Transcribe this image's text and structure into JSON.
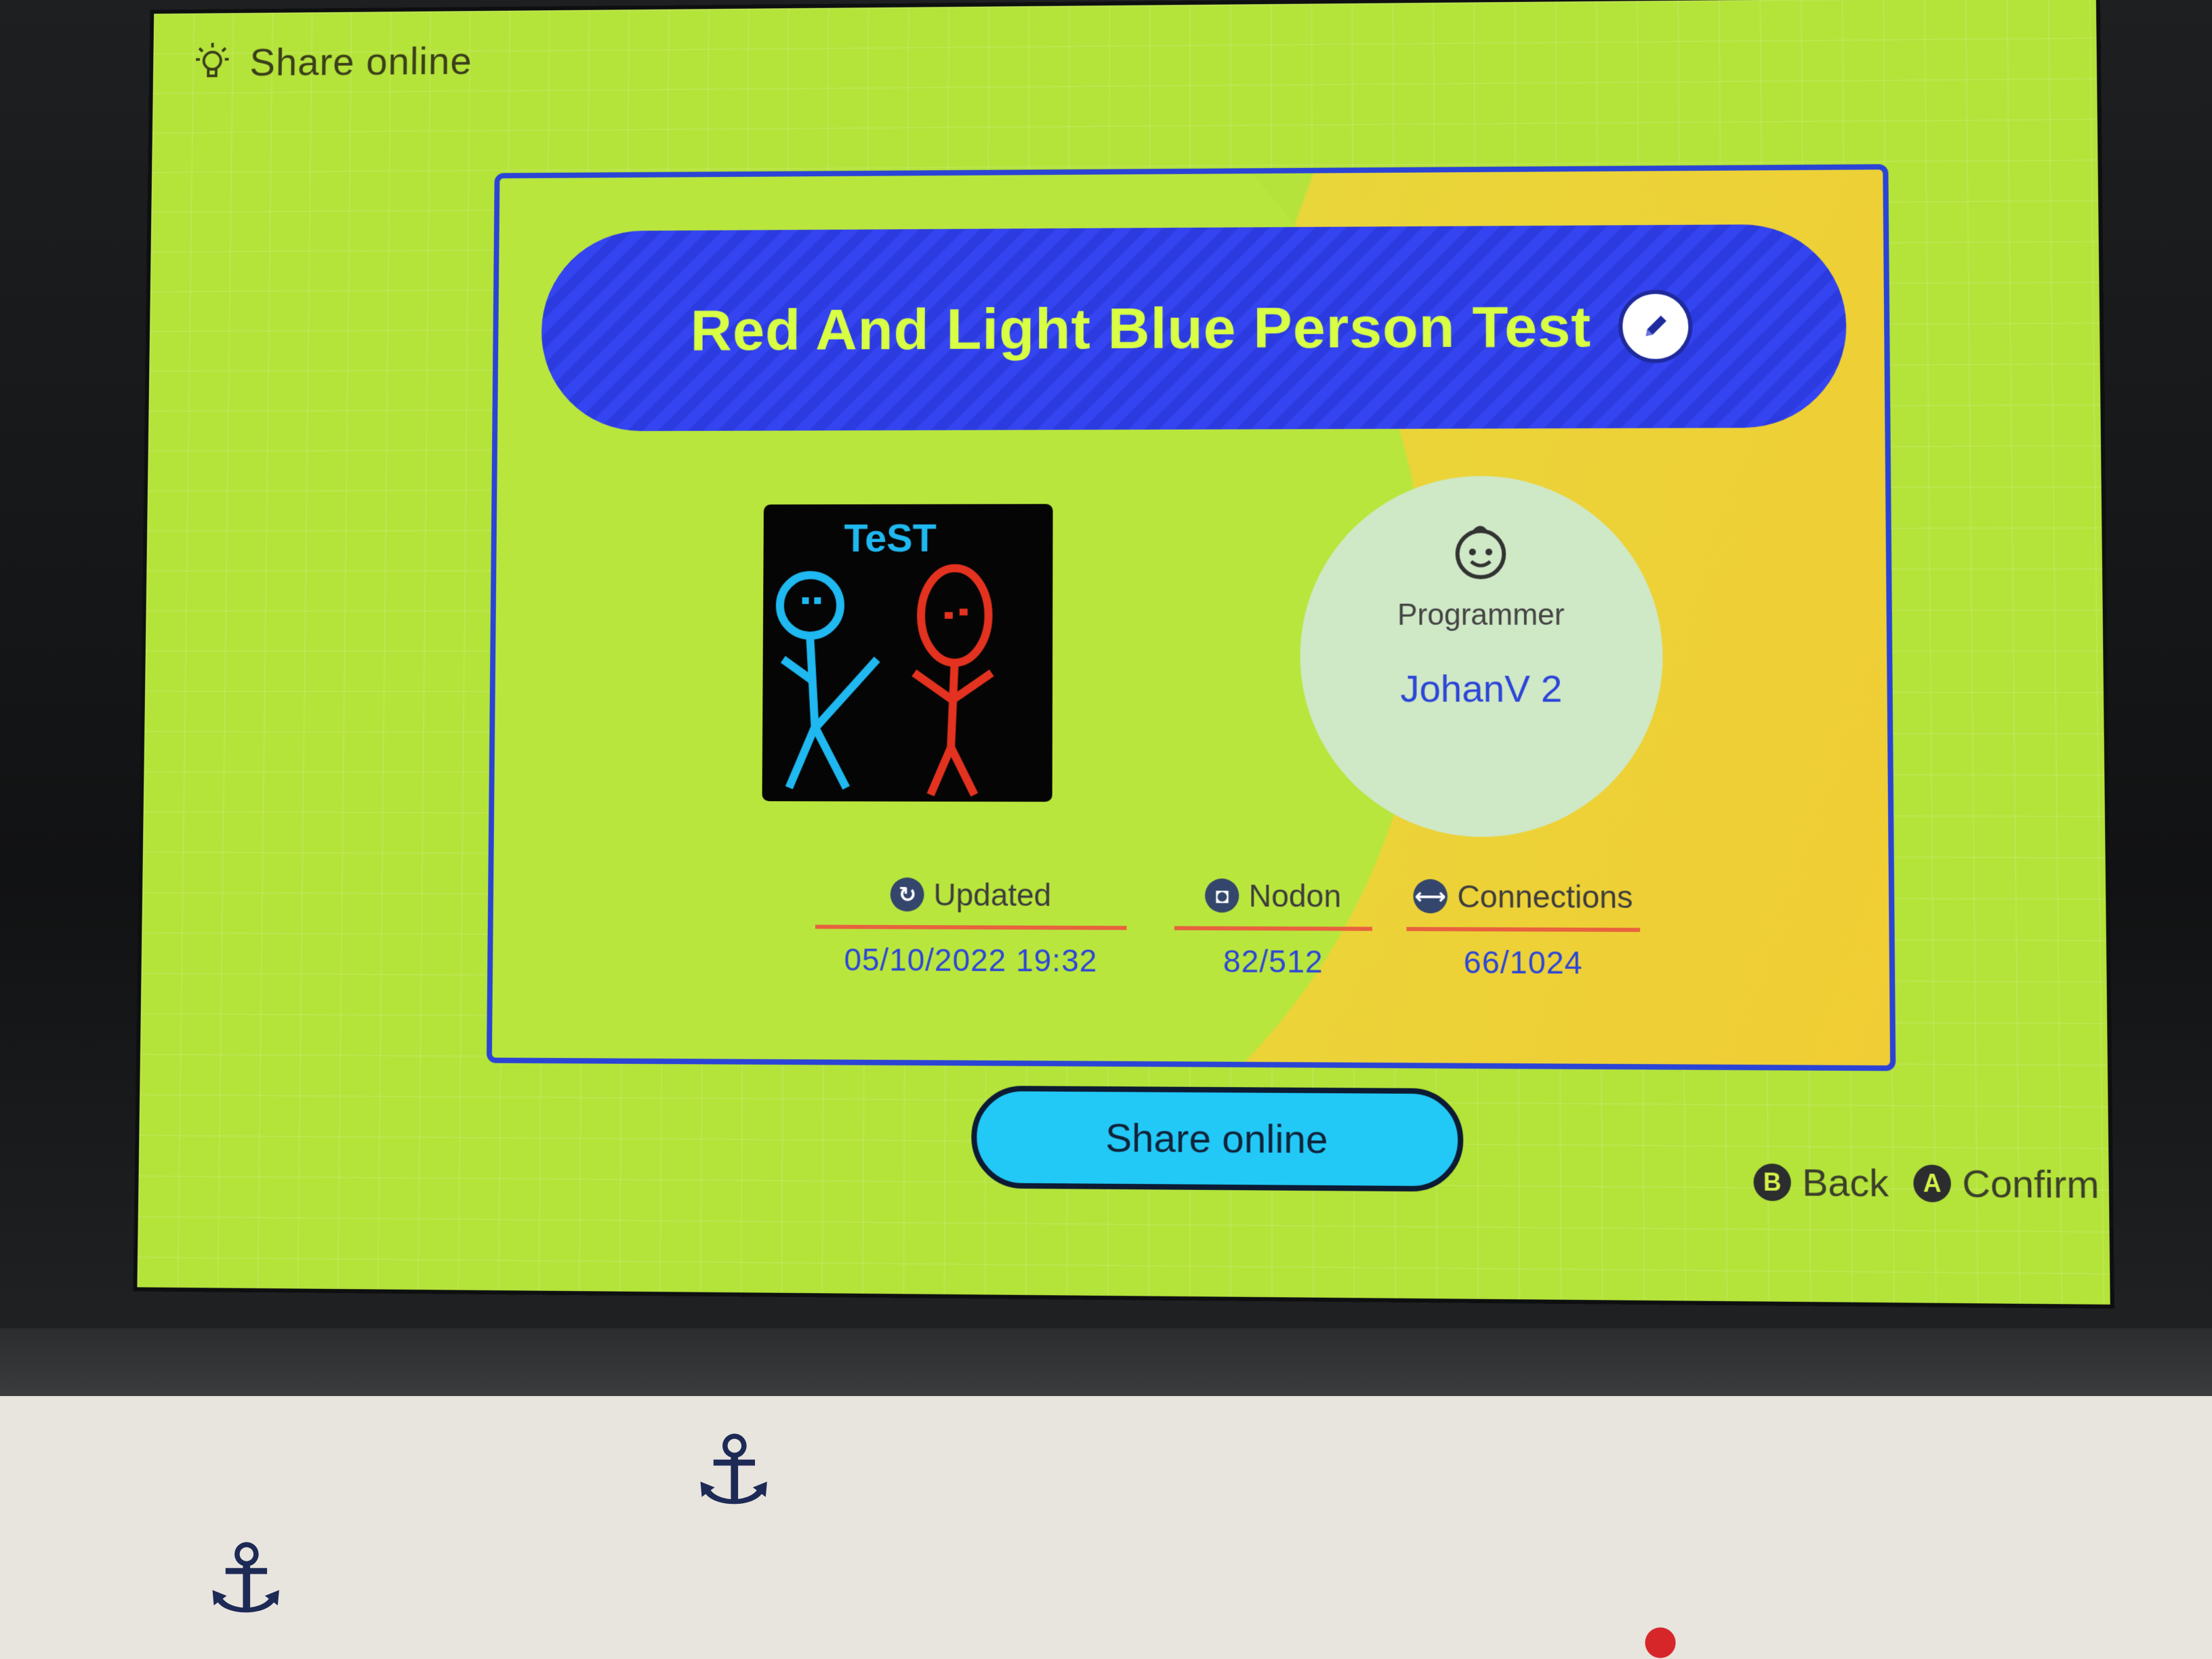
{
  "header": {
    "title": "Share online",
    "icon": "lightbulb-icon"
  },
  "level": {
    "title": "Red And Light Blue Person Test",
    "programmer_label": "Programmer",
    "programmer_name": "JohanV 2",
    "thumbnail_text": "TeST"
  },
  "stats": {
    "updated": {
      "label": "Updated",
      "value": "05/10/2022 19:32",
      "icon": "refresh-icon"
    },
    "nodon": {
      "label": "Nodon",
      "value": "82/512",
      "icon": "nodon-icon"
    },
    "connections": {
      "label": "Connections",
      "value": "66/1024",
      "icon": "connection-icon"
    }
  },
  "actions": {
    "share_label": "Share online",
    "back_button": "B",
    "back_label": "Back",
    "confirm_button": "A",
    "confirm_label": "Confirm"
  },
  "colors": {
    "background": "#b4e33a",
    "panel_border": "#2b44d6",
    "title_bar": "#3444f0",
    "title_text": "#d8ff43",
    "share_button": "#22c9f6",
    "accent_rule": "#e8623e"
  }
}
